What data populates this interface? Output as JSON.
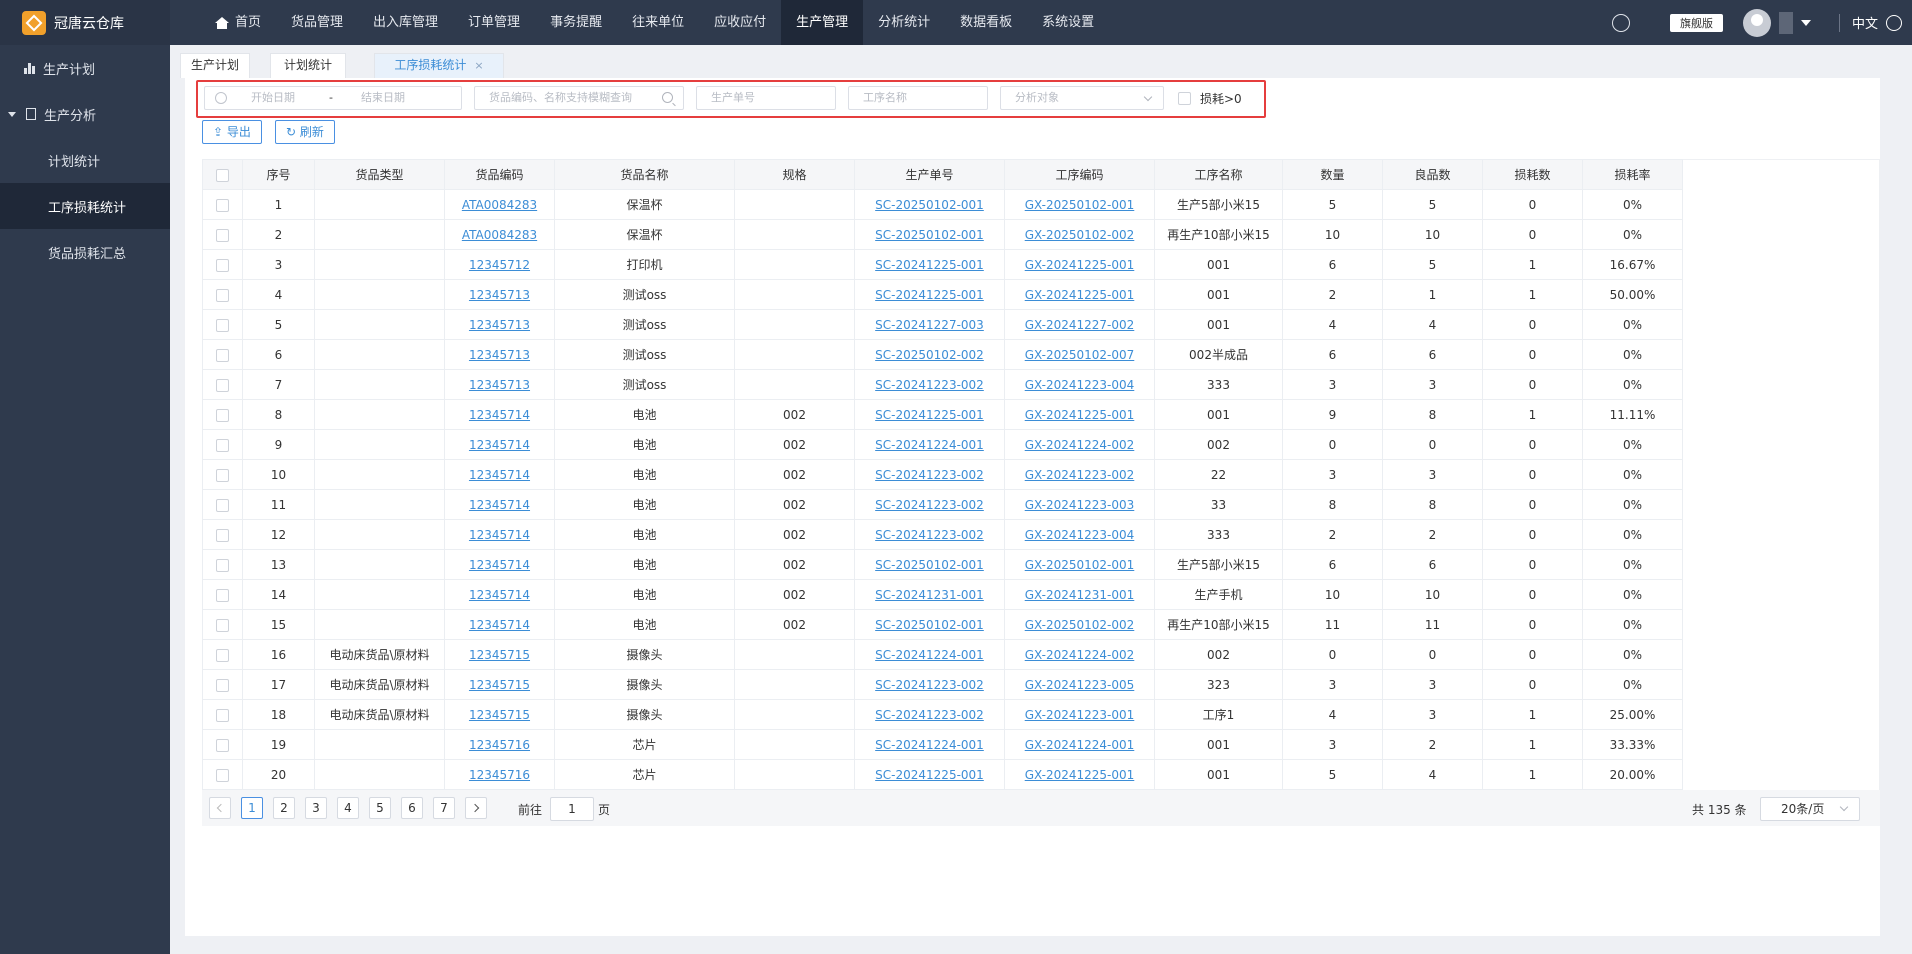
{
  "app": {
    "title": "冠唐云仓库"
  },
  "topnav": [
    {
      "label": "首页",
      "active": false
    },
    {
      "label": "货品管理",
      "active": false
    },
    {
      "label": "出入库管理",
      "active": false
    },
    {
      "label": "订单管理",
      "active": false
    },
    {
      "label": "事务提醒",
      "active": false
    },
    {
      "label": "往来单位",
      "active": false
    },
    {
      "label": "应收应付",
      "active": false
    },
    {
      "label": "生产管理",
      "active": true
    },
    {
      "label": "分析统计",
      "active": false
    },
    {
      "label": "数据看板",
      "active": false
    },
    {
      "label": "系统设置",
      "active": false
    }
  ],
  "topright": {
    "badge": "旗舰版",
    "language": "中文"
  },
  "sidebar": {
    "items": [
      {
        "label": "生产计划"
      },
      {
        "label": "生产分析"
      },
      {
        "label": "计划统计"
      },
      {
        "label": "工序损耗统计"
      },
      {
        "label": "货品损耗汇总"
      }
    ]
  },
  "tabs": [
    {
      "label": "生产计划"
    },
    {
      "label": "计划统计"
    },
    {
      "label": "工序损耗统计"
    }
  ],
  "tab_close": "×",
  "filters": {
    "start_date": "开始日期",
    "date_sep": "-",
    "end_date": "结束日期",
    "goods_search": "货品编码、名称支持模糊查询",
    "order_no": "生产单号",
    "process_name": "工序名称",
    "analysis_target": "分析对象",
    "loss_checkbox": "损耗>0"
  },
  "actions": {
    "export": "⇪ 导出",
    "refresh": "↻ 刷新"
  },
  "table": {
    "headers": [
      "序号",
      "货品类型",
      "货品编码",
      "货品名称",
      "规格",
      "生产单号",
      "工序编码",
      "工序名称",
      "数量",
      "良品数",
      "损耗数",
      "损耗率"
    ],
    "rows": [
      [
        "1",
        "",
        "ATA0084283",
        "保温杯",
        "",
        "SC-20250102-001",
        "GX-20250102-001",
        "生产5部小米15",
        "5",
        "5",
        "0",
        "0%"
      ],
      [
        "2",
        "",
        "ATA0084283",
        "保温杯",
        "",
        "SC-20250102-001",
        "GX-20250102-002",
        "再生产10部小米15",
        "10",
        "10",
        "0",
        "0%"
      ],
      [
        "3",
        "",
        "12345712",
        "打印机",
        "",
        "SC-20241225-001",
        "GX-20241225-001",
        "001",
        "6",
        "5",
        "1",
        "16.67%"
      ],
      [
        "4",
        "",
        "12345713",
        "测试oss",
        "",
        "SC-20241225-001",
        "GX-20241225-001",
        "001",
        "2",
        "1",
        "1",
        "50.00%"
      ],
      [
        "5",
        "",
        "12345713",
        "测试oss",
        "",
        "SC-20241227-003",
        "GX-20241227-002",
        "001",
        "4",
        "4",
        "0",
        "0%"
      ],
      [
        "6",
        "",
        "12345713",
        "测试oss",
        "",
        "SC-20250102-002",
        "GX-20250102-007",
        "002半成品",
        "6",
        "6",
        "0",
        "0%"
      ],
      [
        "7",
        "",
        "12345713",
        "测试oss",
        "",
        "SC-20241223-002",
        "GX-20241223-004",
        "333",
        "3",
        "3",
        "0",
        "0%"
      ],
      [
        "8",
        "",
        "12345714",
        "电池",
        "002",
        "SC-20241225-001",
        "GX-20241225-001",
        "001",
        "9",
        "8",
        "1",
        "11.11%"
      ],
      [
        "9",
        "",
        "12345714",
        "电池",
        "002",
        "SC-20241224-001",
        "GX-20241224-002",
        "002",
        "0",
        "0",
        "0",
        "0%"
      ],
      [
        "10",
        "",
        "12345714",
        "电池",
        "002",
        "SC-20241223-002",
        "GX-20241223-002",
        "22",
        "3",
        "3",
        "0",
        "0%"
      ],
      [
        "11",
        "",
        "12345714",
        "电池",
        "002",
        "SC-20241223-002",
        "GX-20241223-003",
        "33",
        "8",
        "8",
        "0",
        "0%"
      ],
      [
        "12",
        "",
        "12345714",
        "电池",
        "002",
        "SC-20241223-002",
        "GX-20241223-004",
        "333",
        "2",
        "2",
        "0",
        "0%"
      ],
      [
        "13",
        "",
        "12345714",
        "电池",
        "002",
        "SC-20250102-001",
        "GX-20250102-001",
        "生产5部小米15",
        "6",
        "6",
        "0",
        "0%"
      ],
      [
        "14",
        "",
        "12345714",
        "电池",
        "002",
        "SC-20241231-001",
        "GX-20241231-001",
        "生产手机",
        "10",
        "10",
        "0",
        "0%"
      ],
      [
        "15",
        "",
        "12345714",
        "电池",
        "002",
        "SC-20250102-001",
        "GX-20250102-002",
        "再生产10部小米15",
        "11",
        "11",
        "0",
        "0%"
      ],
      [
        "16",
        "电动床货品\\原材料",
        "12345715",
        "摄像头",
        "",
        "SC-20241224-001",
        "GX-20241224-002",
        "002",
        "0",
        "0",
        "0",
        "0%"
      ],
      [
        "17",
        "电动床货品\\原材料",
        "12345715",
        "摄像头",
        "",
        "SC-20241223-002",
        "GX-20241223-005",
        "323",
        "3",
        "3",
        "0",
        "0%"
      ],
      [
        "18",
        "电动床货品\\原材料",
        "12345715",
        "摄像头",
        "",
        "SC-20241223-002",
        "GX-20241223-001",
        "工序1",
        "4",
        "3",
        "1",
        "25.00%"
      ],
      [
        "19",
        "",
        "12345716",
        "芯片",
        "",
        "SC-20241224-001",
        "GX-20241224-001",
        "001",
        "3",
        "2",
        "1",
        "33.33%"
      ],
      [
        "20",
        "",
        "12345716",
        "芯片",
        "",
        "SC-20241225-001",
        "GX-20241225-001",
        "001",
        "5",
        "4",
        "1",
        "20.00%"
      ]
    ]
  },
  "pagination": {
    "pages": [
      "1",
      "2",
      "3",
      "4",
      "5",
      "6",
      "7"
    ],
    "current": "1",
    "goto_prefix": "前往",
    "goto_value": "1",
    "goto_suffix": "页",
    "total": "共 135 条",
    "page_size": "20条/页"
  }
}
